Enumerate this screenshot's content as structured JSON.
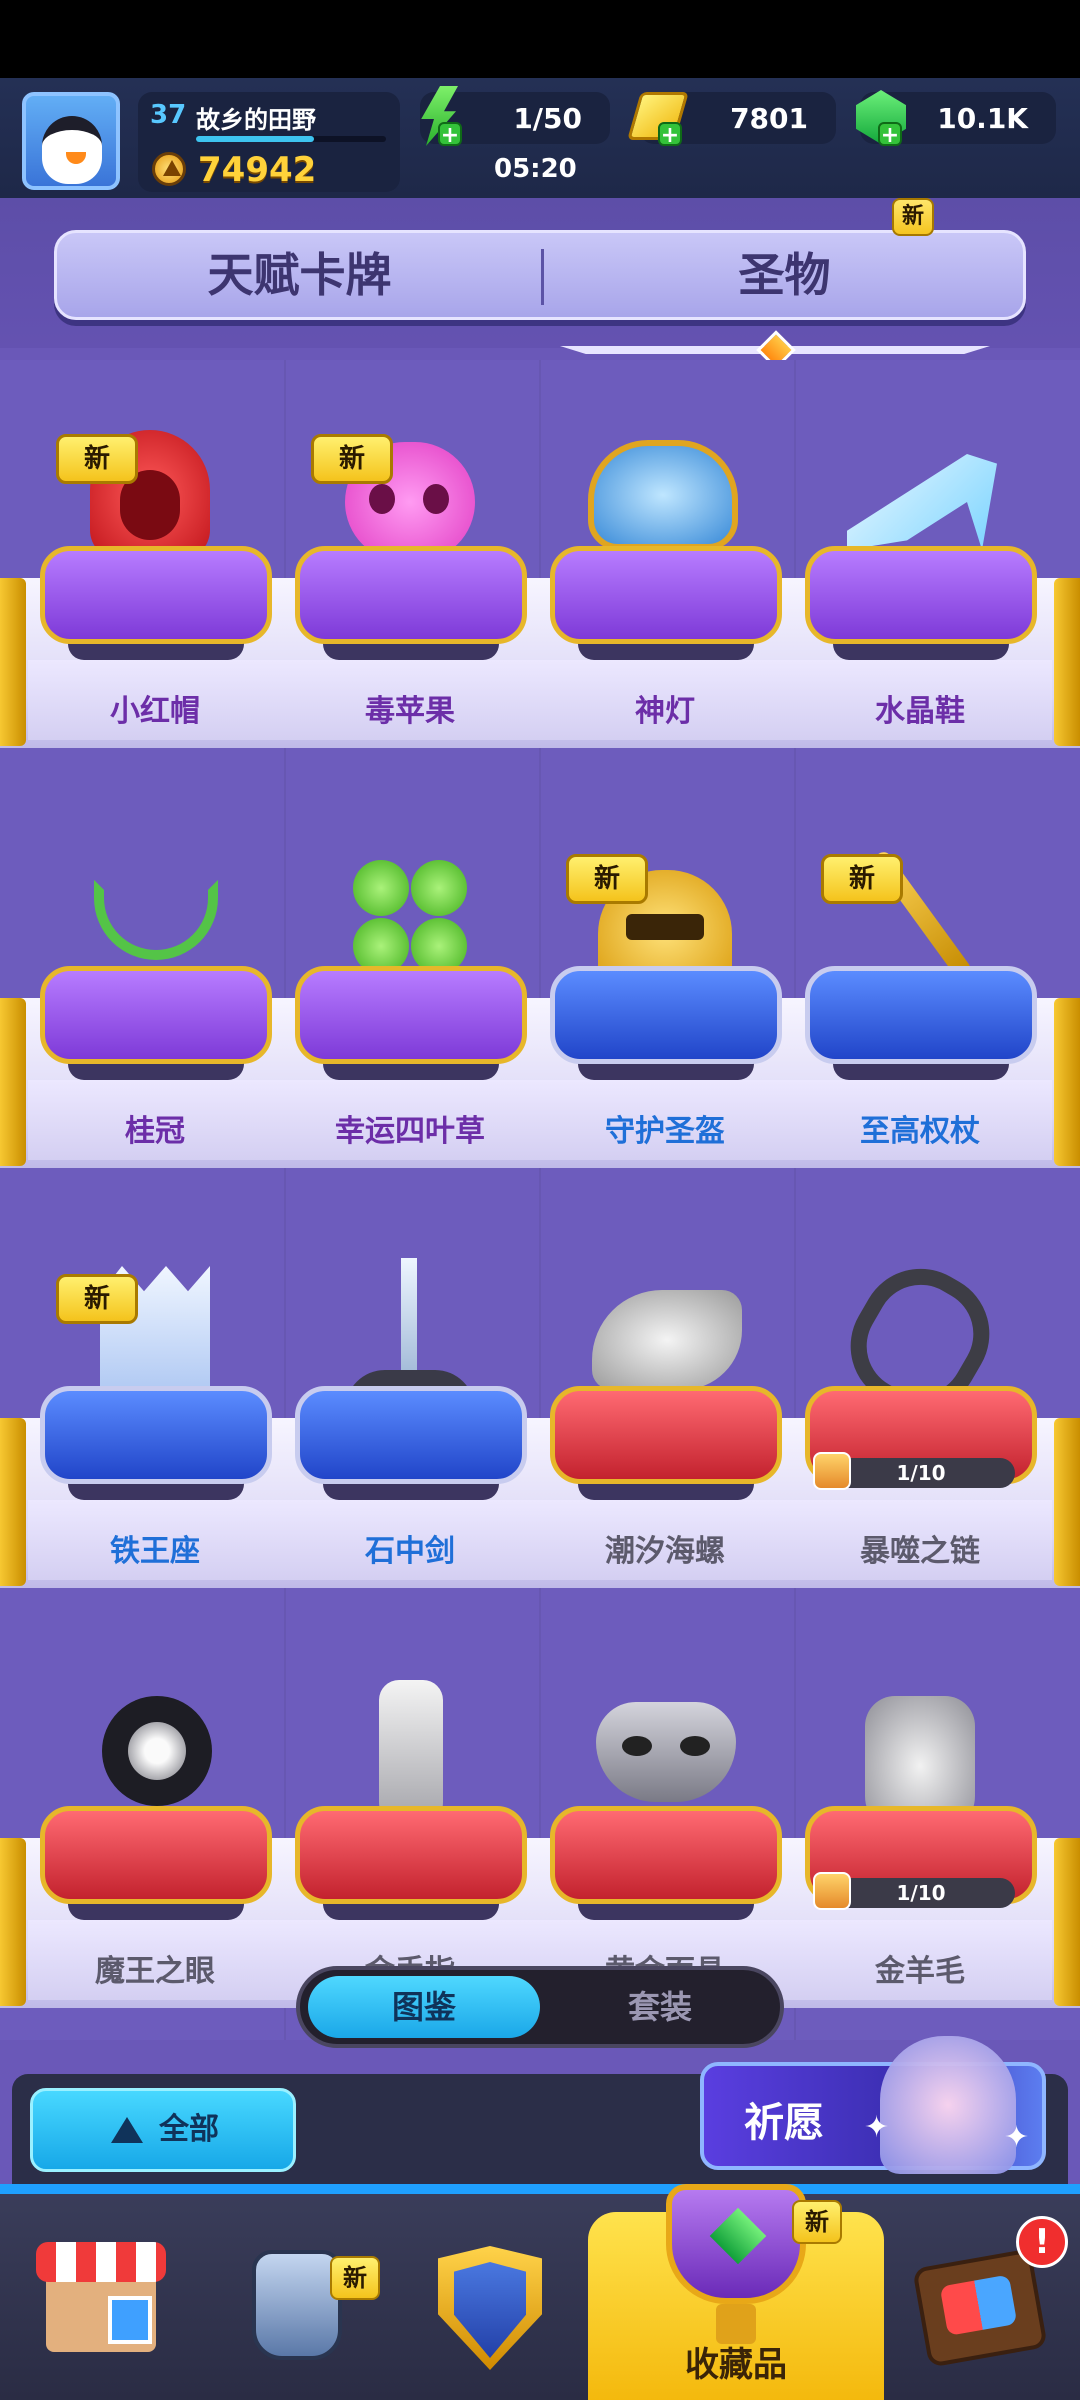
{
  "player": {
    "level": "37",
    "name": "故乡的田野",
    "xp_fraction": 0.62,
    "trophies": "74942"
  },
  "resources": {
    "energy": "1/50",
    "gold": "7801",
    "gems": "10.1K",
    "energy_timer": "05:20"
  },
  "tabs": {
    "talent": "天赋卡牌",
    "relic": "圣物",
    "relic_new": "新",
    "active": "relic"
  },
  "items": [
    {
      "name": "小红帽",
      "new": "新",
      "cushion": "purple",
      "icon": "red-hood-icon"
    },
    {
      "name": "毒苹果",
      "new": "新",
      "cushion": "purple",
      "icon": "poison-apple-icon"
    },
    {
      "name": "神灯",
      "new": "",
      "cushion": "purple",
      "icon": "magic-lamp-icon"
    },
    {
      "name": "水晶鞋",
      "new": "",
      "cushion": "purple",
      "icon": "glass-slipper-icon"
    },
    {
      "name": "桂冠",
      "new": "",
      "cushion": "purple",
      "icon": "laurel-wreath-icon"
    },
    {
      "name": "幸运四叶草",
      "new": "",
      "cushion": "purple",
      "icon": "four-leaf-clover-icon"
    },
    {
      "name": "守护圣盔",
      "new": "新",
      "cushion": "blue",
      "icon": "guardian-helmet-icon"
    },
    {
      "name": "至高权杖",
      "new": "新",
      "cushion": "blue",
      "icon": "scepter-icon"
    },
    {
      "name": "铁王座",
      "new": "新",
      "cushion": "blue",
      "icon": "iron-throne-icon"
    },
    {
      "name": "石中剑",
      "new": "",
      "cushion": "blue",
      "icon": "sword-in-stone-icon"
    },
    {
      "name": "潮汐海螺",
      "new": "",
      "cushion": "red",
      "icon": "conch-shell-icon"
    },
    {
      "name": "暴噬之链",
      "new": "",
      "cushion": "red",
      "icon": "chain-icon",
      "progress": "1/10"
    },
    {
      "name": "魔王之眼",
      "new": "",
      "cushion": "red",
      "icon": "demon-eye-icon"
    },
    {
      "name": "金手指",
      "new": "",
      "cushion": "red",
      "icon": "golden-finger-icon"
    },
    {
      "name": "黄金面具",
      "new": "",
      "cushion": "red",
      "icon": "golden-mask-icon"
    },
    {
      "name": "金羊毛",
      "new": "",
      "cushion": "red",
      "icon": "golden-fleece-icon",
      "progress": "1/10"
    }
  ],
  "segment": {
    "catalog": "图鉴",
    "set": "套装",
    "active": "catalog"
  },
  "filter": {
    "label": "全部"
  },
  "wish": {
    "label": "祈愿"
  },
  "bottom_nav": {
    "collection_label": "收藏品",
    "gear_new": "新",
    "collection_new": "新",
    "events_alert": "!"
  },
  "colors": {
    "accent_blue": "#1aa7e8",
    "new_badge_yellow": "#f4c31c",
    "purple_name": "#6c2ea8",
    "blue_name": "#1f6fd8"
  }
}
